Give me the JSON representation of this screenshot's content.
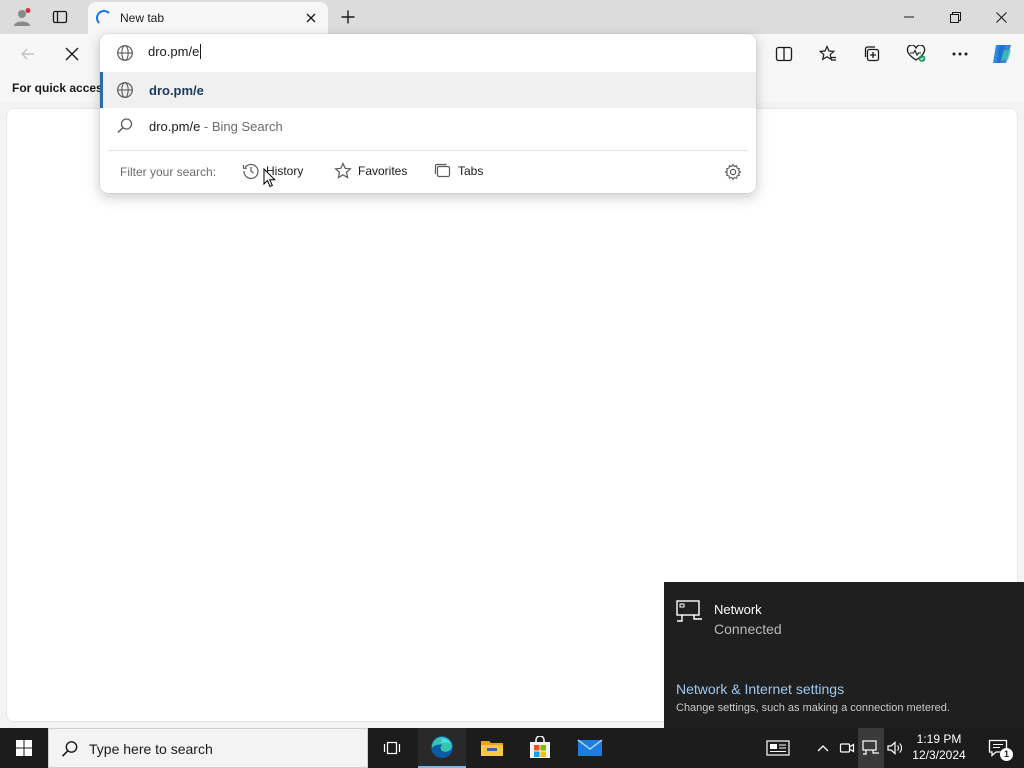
{
  "browser": {
    "tab": {
      "title": "New tab"
    },
    "favorites_bar": {
      "hint": "For quick access"
    }
  },
  "omnibox": {
    "input_value": "dro.pm/e",
    "suggestions": [
      {
        "text": "dro.pm/e",
        "icon": "globe-icon"
      },
      {
        "query": "dro.pm/e",
        "suffix": " - Bing Search",
        "icon": "search-icon"
      }
    ],
    "filter": {
      "label": "Filter your search:",
      "chips": [
        {
          "label": "History",
          "icon": "history-icon"
        },
        {
          "label": "Favorites",
          "icon": "star-icon"
        },
        {
          "label": "Tabs",
          "icon": "tabs-icon"
        }
      ]
    }
  },
  "network_flyout": {
    "name": "Network",
    "status": "Connected",
    "settings_link": "Network & Internet settings",
    "settings_desc": "Change settings, such as making a connection metered."
  },
  "taskbar": {
    "search_placeholder": "Type here to search",
    "time": "1:19 PM",
    "date": "12/3/2024",
    "notification_count": "1"
  },
  "colors": {
    "accent": "#2b6cb0",
    "link": "#9cc9ef",
    "taskbar": "#1c1c1c",
    "flyout": "#1f1f1f"
  }
}
